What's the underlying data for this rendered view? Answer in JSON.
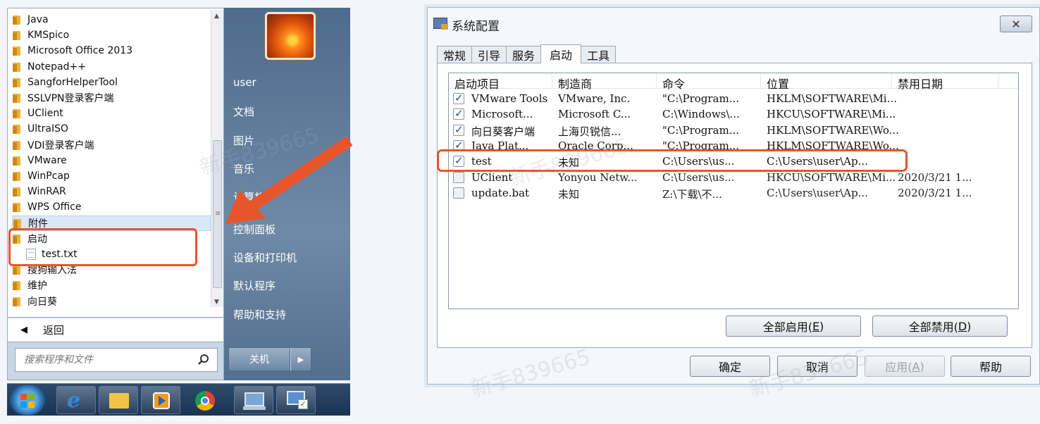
{
  "start_menu": {
    "programs": [
      {
        "label": "Java",
        "type": "folder"
      },
      {
        "label": "KMSpico",
        "type": "folder"
      },
      {
        "label": "Microsoft Office 2013",
        "type": "folder"
      },
      {
        "label": "Notepad++",
        "type": "folder"
      },
      {
        "label": "SangforHelperTool",
        "type": "folder"
      },
      {
        "label": "SSLVPN登录客户端",
        "type": "folder"
      },
      {
        "label": "UClient",
        "type": "folder"
      },
      {
        "label": "UltraISO",
        "type": "folder"
      },
      {
        "label": "VDI登录客户端",
        "type": "folder"
      },
      {
        "label": "VMware",
        "type": "folder"
      },
      {
        "label": "WinPcap",
        "type": "folder"
      },
      {
        "label": "WinRAR",
        "type": "folder"
      },
      {
        "label": "WPS Office",
        "type": "folder"
      },
      {
        "label": "附件",
        "type": "folder"
      },
      {
        "label": "启动",
        "type": "folder"
      },
      {
        "label": "test.txt",
        "type": "file"
      },
      {
        "label": "搜狗输入法",
        "type": "folder"
      },
      {
        "label": "维护",
        "type": "folder"
      },
      {
        "label": "向日葵",
        "type": "folder"
      }
    ],
    "back_label": "返回",
    "search_placeholder": "搜索程序和文件",
    "right_items": [
      "user",
      "文档",
      "图片",
      "音乐",
      "计算机",
      "控制面板",
      "设备和打印机",
      "默认程序",
      "帮助和支持"
    ],
    "shutdown_label": "关机"
  },
  "taskbar": {
    "icons": [
      "windows-start-orb-icon",
      "internet-explorer-icon",
      "file-explorer-icon",
      "media-player-icon",
      "chrome-icon",
      "network-computer-icon",
      "system-config-icon"
    ]
  },
  "dialog": {
    "title": "系统配置",
    "close_symbol": "✕",
    "tabs": [
      "常规",
      "引导",
      "服务",
      "启动",
      "工具"
    ],
    "active_tab": "启动",
    "columns": [
      "启动项目",
      "制造商",
      "命令",
      "位置",
      "禁用日期"
    ],
    "rows": [
      {
        "checked": true,
        "item": "VMware Tools",
        "maker": "VMware, Inc.",
        "command": "\"C:\\Program...",
        "location": "HKLM\\SOFTWARE\\Mi...",
        "disabled_date": ""
      },
      {
        "checked": true,
        "item": "Microsoft...",
        "maker": "Microsoft C...",
        "command": "C:\\Windows\\...",
        "location": "HKCU\\SOFTWARE\\Mi...",
        "disabled_date": ""
      },
      {
        "checked": true,
        "item": "向日葵客户端",
        "maker": "上海贝锐信...",
        "command": "\"C:\\Program...",
        "location": "HKLM\\SOFTWARE\\Wo...",
        "disabled_date": ""
      },
      {
        "checked": true,
        "item": "Java Plat...",
        "maker": "Oracle Corp...",
        "command": "\"C:\\Program...",
        "location": "HKLM\\SOFTWARE\\Wo...",
        "disabled_date": ""
      },
      {
        "checked": true,
        "item": "test",
        "maker": "未知",
        "command": "C:\\Users\\us...",
        "location": "C:\\Users\\user\\Ap...",
        "disabled_date": ""
      },
      {
        "checked": false,
        "item": "UClient",
        "maker": "Yonyou Netw...",
        "command": "C:\\Users\\us...",
        "location": "HKCU\\SOFTWARE\\Mi...",
        "disabled_date": "2020/3/21 1..."
      },
      {
        "checked": false,
        "item": "update.bat",
        "maker": "未知",
        "command": "Z:\\下载\\不...",
        "location": "C:\\Users\\user\\Ap...",
        "disabled_date": "2020/3/21 1..."
      }
    ],
    "enable_all": {
      "text": "全部启用(",
      "key": "E",
      "end": ")"
    },
    "disable_all": {
      "text": "全部禁用(",
      "key": "D",
      "end": ")"
    },
    "ok_label": "确定",
    "cancel_label": "取消",
    "apply": {
      "text": "应用(",
      "key": "A",
      "end": ")"
    },
    "help_label": "帮助"
  },
  "watermark": "新手839665",
  "colors": {
    "highlight": "#e8552b",
    "start_menu_right": "#5f7b9a",
    "taskbar": "#23405f"
  }
}
